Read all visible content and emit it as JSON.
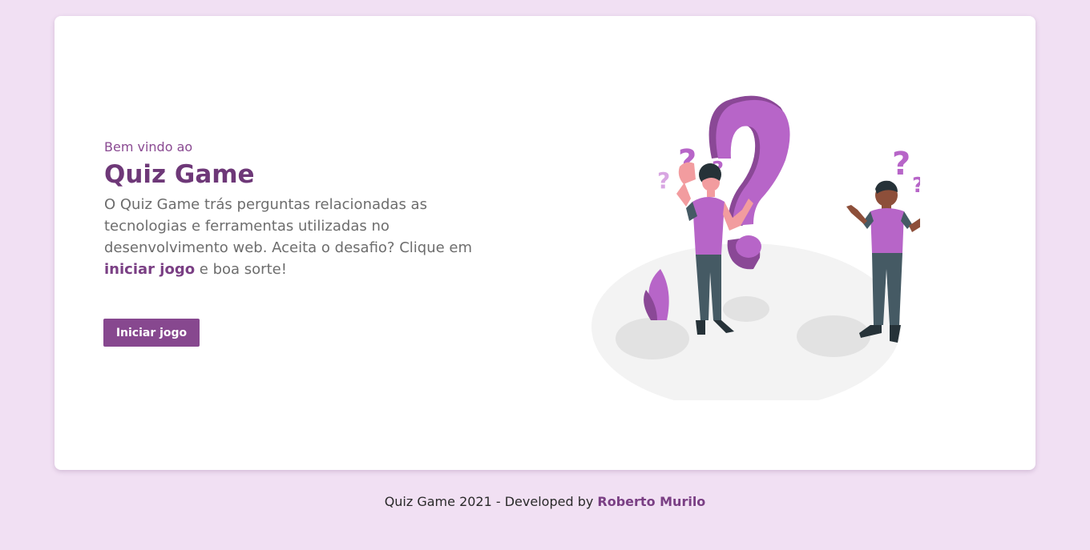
{
  "hero": {
    "welcome": "Bem vindo ao",
    "title": "Quiz Game",
    "description_before": "O Quiz Game trás perguntas relacionadas as tecnologias e ferramentas utilizadas no desenvolvimento web. Aceita o desafio? Clique em ",
    "description_highlight": "iniciar jogo",
    "description_after": " e boa sorte!",
    "start_button": "Iniciar jogo"
  },
  "illustration": {
    "icon": "question-people-illustration",
    "question_mark": "?"
  },
  "footer": {
    "text": "Quiz Game 2021 - Developed by ",
    "author": "Roberto Murilo"
  },
  "colors": {
    "background": "#f1e0f3",
    "accent": "#87488f",
    "title": "#6e3878",
    "illustration_purple": "#b765c8"
  }
}
